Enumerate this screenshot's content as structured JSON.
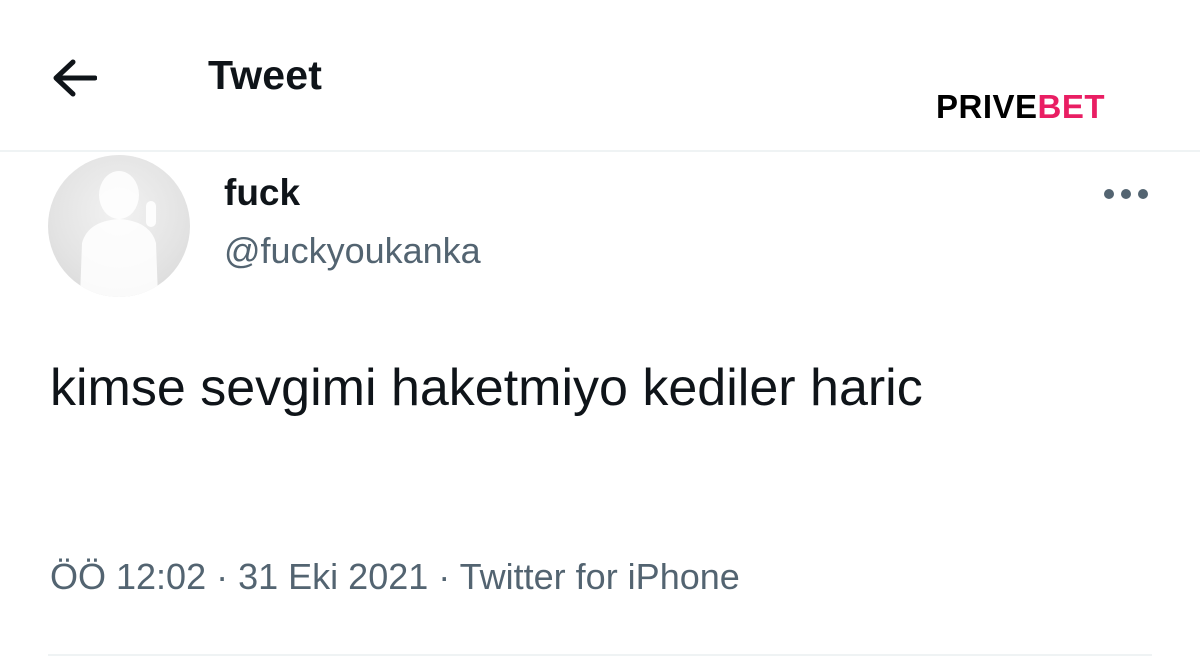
{
  "header": {
    "back_icon": "arrow-left-icon",
    "title": "Tweet"
  },
  "brand": {
    "part_a": "PRIVE",
    "part_b": "BET",
    "color_a": "#000000",
    "color_b": "#e91e63"
  },
  "tweet": {
    "display_name": "fuck",
    "handle": "@fuckyoukanka",
    "more_icon": "more-horizontal-icon",
    "text": "kimse sevgimi haketmiyo kediler haric",
    "time": "ÖÖ 12:02",
    "separator": "·",
    "date": "31 Eki 2021",
    "source": "Twitter for iPhone"
  },
  "colors": {
    "text_primary": "#0f1419",
    "text_secondary": "#536471",
    "divider": "#eff3f4"
  }
}
